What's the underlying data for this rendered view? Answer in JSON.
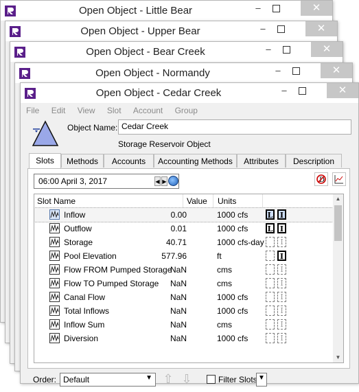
{
  "windows": [
    {
      "title": "Open Object - Little Bear"
    },
    {
      "title": "Open Object - Upper Bear"
    },
    {
      "title": "Open Object - Bear Creek"
    },
    {
      "title": "Open Object - Normandy"
    },
    {
      "title": "Open Object - Cedar Creek"
    }
  ],
  "window_controls": {
    "minimize": "–",
    "close": "✕"
  },
  "menu": [
    "File",
    "Edit",
    "View",
    "Slot",
    "Account",
    "Group"
  ],
  "object": {
    "name_label": "Object Name:",
    "name": "Cedar Creek",
    "type": "Storage Reservoir Object"
  },
  "tabs": [
    "Slots",
    "Methods",
    "Accounts",
    "Accounting Methods",
    "Attributes",
    "Description"
  ],
  "active_tab": "Slots",
  "date": "06:00 April 3, 2017",
  "columns": {
    "name": "Slot Name",
    "value": "Value",
    "units": "Units"
  },
  "slots": [
    {
      "name": "Inflow",
      "value": "0.00",
      "units": "1000 cfs",
      "f1": "L",
      "f1s": "blue",
      "f2": "I",
      "f2s": "blue",
      "selected": true
    },
    {
      "name": "Outflow",
      "value": "0.01",
      "units": "1000 cfs",
      "f1": "L",
      "f1s": "on",
      "f2": "I",
      "f2s": "on"
    },
    {
      "name": "Storage",
      "value": "40.71",
      "units": "1000 cfs-day",
      "f1": "",
      "f1s": "off",
      "f2": "I",
      "f2s": "off"
    },
    {
      "name": "Pool Elevation",
      "value": "577.96",
      "units": "ft",
      "f1": "",
      "f1s": "off",
      "f2": "I",
      "f2s": "on"
    },
    {
      "name": "Flow FROM Pumped Storage",
      "value": "NaN",
      "units": "cms",
      "f1": "",
      "f1s": "off",
      "f2": "I",
      "f2s": "off"
    },
    {
      "name": "Flow TO Pumped Storage",
      "value": "NaN",
      "units": "cms",
      "f1": "",
      "f1s": "off",
      "f2": "I",
      "f2s": "off"
    },
    {
      "name": "Canal Flow",
      "value": "NaN",
      "units": "1000 cfs",
      "f1": "",
      "f1s": "off",
      "f2": "I",
      "f2s": "off"
    },
    {
      "name": "Total Inflows",
      "value": "NaN",
      "units": "1000 cfs",
      "f1": "",
      "f1s": "off",
      "f2": "I",
      "f2s": "off"
    },
    {
      "name": "Inflow Sum",
      "value": "NaN",
      "units": "cms",
      "f1": "",
      "f1s": "off",
      "f2": "I",
      "f2s": "off"
    },
    {
      "name": "Diversion",
      "value": "NaN",
      "units": "1000 cfs",
      "f1": "",
      "f1s": "off",
      "f2": "I",
      "f2s": "off"
    }
  ],
  "order": {
    "label": "Order:",
    "value": "Default"
  },
  "filter": {
    "label": "Filter Slots",
    "checked": false
  }
}
